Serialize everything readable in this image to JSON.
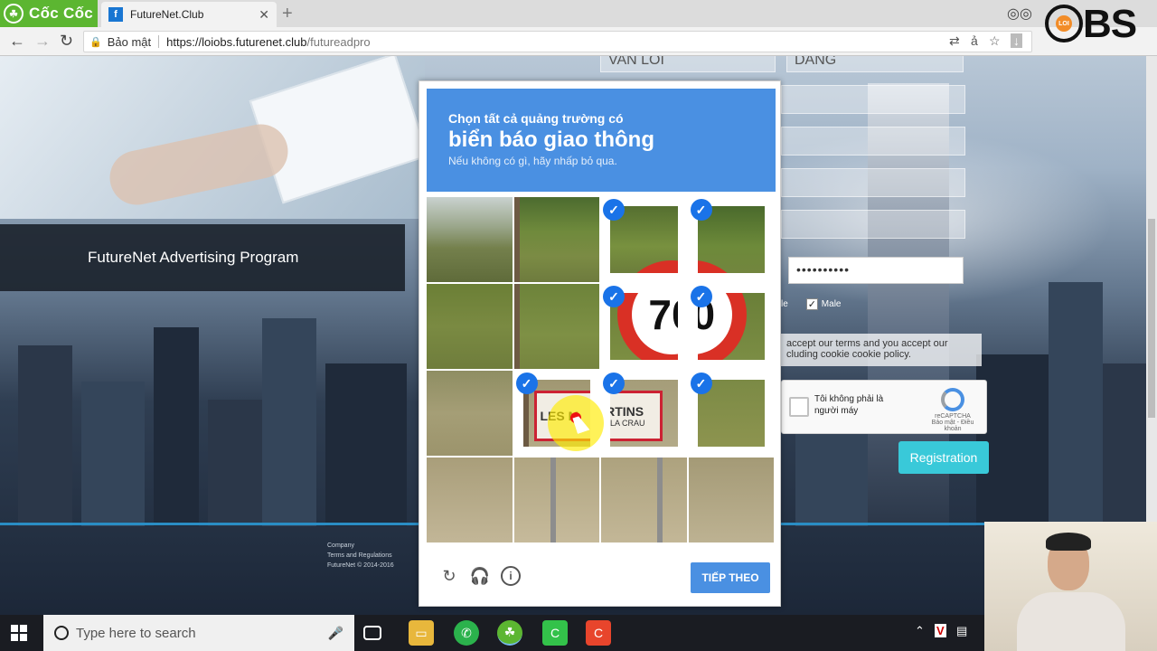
{
  "browser": {
    "app_name": "Cốc Cốc",
    "tab_title": "FutureNet.Club",
    "security_label": "Bảo mật",
    "url_host": "https://loiobs.futurenet.club",
    "url_path": "/futureadpro"
  },
  "page": {
    "banner_title": "FutureNet Advertising Program",
    "form_first_name": "VAN LOI",
    "form_last_name": "DANG",
    "password_value": "••••••••••",
    "gender_label_partial": "le",
    "gender_male_label": "Male",
    "terms_line1": "accept our terms and you accept our",
    "terms_line2": "cluding cookie cookie policy.",
    "recaptcha_checkbox_label": "Tôi không phải là người máy",
    "recaptcha_brand": "reCAPTCHA",
    "recaptcha_links": "Bảo mật - Điều khoản",
    "registration_button": "Registration",
    "footer_company": "Company",
    "footer_terms": "Terms and Regulations",
    "footer_copyright": "FutureNet © 2014-2016"
  },
  "captcha": {
    "instruction_line1": "Chọn tất cả quảng trường có",
    "instruction_line2": "biển báo giao thông",
    "instruction_line3": "Nếu không có gì, hãy nhấp bỏ qua.",
    "tiles": [
      {
        "selected": false
      },
      {
        "selected": false
      },
      {
        "selected": true
      },
      {
        "selected": true
      },
      {
        "selected": false
      },
      {
        "selected": false
      },
      {
        "selected": true
      },
      {
        "selected": true
      },
      {
        "selected": false
      },
      {
        "selected": true
      },
      {
        "selected": true
      },
      {
        "selected": true
      },
      {
        "selected": false
      },
      {
        "selected": false
      },
      {
        "selected": false
      },
      {
        "selected": false
      }
    ],
    "sign_speed": "70",
    "sign_text_left": "LES M",
    "sign_text_right": "ARTINS",
    "sign_sub": "DE LA CRAU",
    "verify_button": "TIẾP THEO"
  },
  "overlay": {
    "obs_letters": "BS",
    "obs_badge": "LOI"
  },
  "taskbar": {
    "search_placeholder": "Type here to search"
  },
  "colors": {
    "captcha_blue": "#4a90e2",
    "registration_cyan": "#39c9d9",
    "coccoc_green": "#5cb631"
  }
}
